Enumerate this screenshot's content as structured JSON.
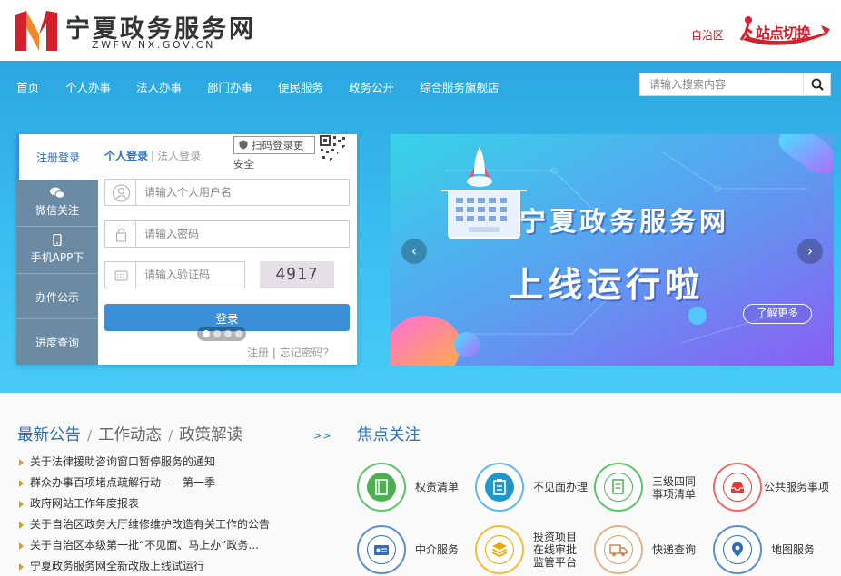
{
  "site": {
    "title": "宁夏政务服务网",
    "domain": "ZWFW.NX.GOV.CN",
    "region": "自治区",
    "switch_label": "站点切换"
  },
  "colors": {
    "brand_red": "#d3202a",
    "brand_blue": "#2e6fb8",
    "nav_bg": "#2ca6e0",
    "login_btn": "#3b8fd8"
  },
  "nav": {
    "items": [
      "首页",
      "个人办事",
      "法人办事",
      "部门办事",
      "便民服务",
      "政务公开",
      "综合服务旗舰店"
    ]
  },
  "search": {
    "placeholder": "请输入搜索内容",
    "icon": "search-icon"
  },
  "login": {
    "register_tab": "注册登录",
    "tab_personal": "个人登录",
    "tab_sep": "|",
    "tab_corporate": "法人登录",
    "qr_tip_line1": "扫码登录更",
    "qr_tip_line2": "安全",
    "side": [
      "微信关注",
      "手机APP下",
      "办件公示",
      "进度查询"
    ],
    "username_placeholder": "请输入个人用户名",
    "password_placeholder": "请输入密码",
    "captcha_placeholder": "请输入验证码",
    "captcha_text": "4917",
    "submit": "登录",
    "register_link": "注册",
    "link_sep": "|",
    "forgot_link": "忘记密码？"
  },
  "banner": {
    "title": "宁夏政务服务网",
    "subtitle": "上线运行啦",
    "more": "了解更多",
    "slide_count": 4,
    "active_slide": 1,
    "prev": "‹",
    "next": "›"
  },
  "notices": {
    "tabs": [
      "最新公告",
      "工作动态",
      "政策解读"
    ],
    "tab_sep": "/",
    "more": ">>",
    "items": [
      "关于法律援助咨询窗口暂停服务的通知",
      "群众办事百项堵点疏解行动——第一季",
      "政府网站工作年度报表",
      "关于自治区政务大厅维修维护改造有关工作的公告",
      "关于自治区本级第一批“不见面、马上办”政务...",
      "宁夏政务服务网全新改版上线试运行"
    ]
  },
  "focus": {
    "title": "焦点关注",
    "items": [
      {
        "label": "权责清单",
        "icon": "list-book-icon",
        "color": "#4caf50"
      },
      {
        "label": "不见面办理",
        "icon": "clipboard-icon",
        "color": "#2196c9"
      },
      {
        "label": "三级四同\n事项清单",
        "icon": "document-icon",
        "color": "#4caf50"
      },
      {
        "label": "公共服务事项",
        "icon": "inbox-icon",
        "color": "#e53935"
      },
      {
        "label": "中介服务",
        "icon": "id-card-icon",
        "color": "#2e6fb8"
      },
      {
        "label": "投资项目\n在线审批\n监管平台",
        "icon": "layers-icon",
        "color": "#f0a500"
      },
      {
        "label": "快递查询",
        "icon": "truck-icon",
        "color": "#d9a06a"
      },
      {
        "label": "地图服务",
        "icon": "map-pin-icon",
        "color": "#2e6fb8"
      }
    ]
  }
}
